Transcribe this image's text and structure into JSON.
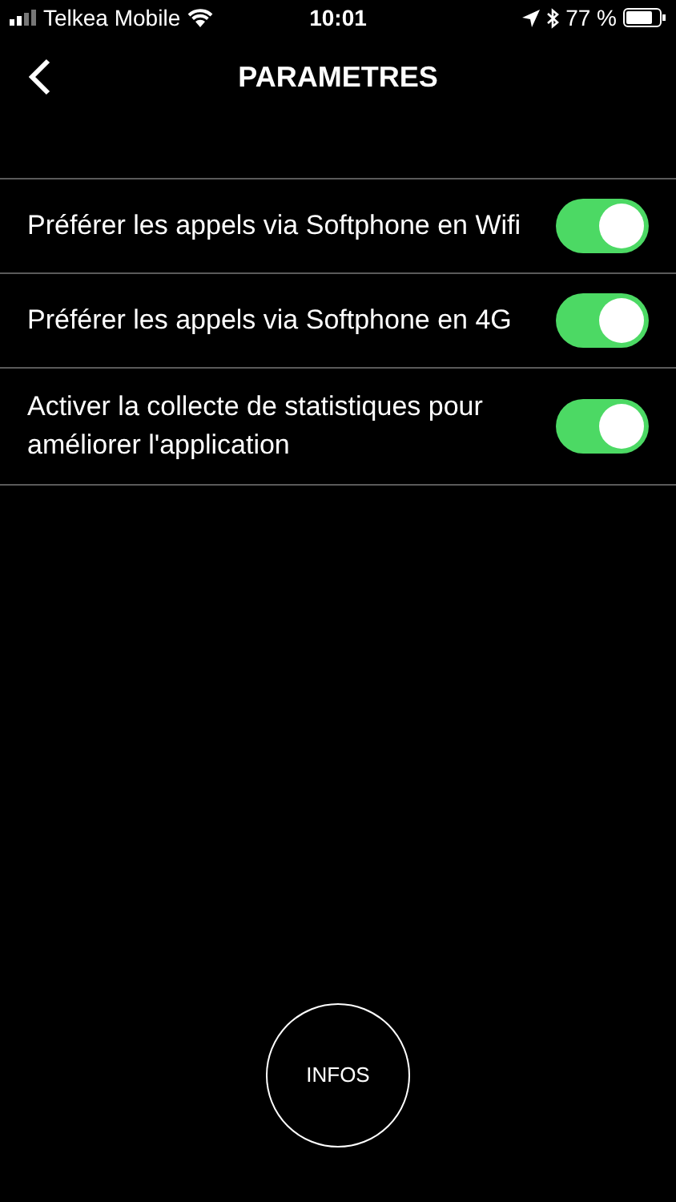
{
  "status_bar": {
    "carrier": "Telkea Mobile",
    "time": "10:01",
    "battery": "77 %"
  },
  "nav": {
    "title": "PARAMETRES"
  },
  "settings": [
    {
      "label": "Préférer les appels via Softphone en Wifi",
      "on": true
    },
    {
      "label": "Préférer les appels via Softphone en 4G",
      "on": true
    },
    {
      "label": "Activer la collecte de statistiques pour améliorer l'application",
      "on": true
    }
  ],
  "infos_button": "INFOS"
}
